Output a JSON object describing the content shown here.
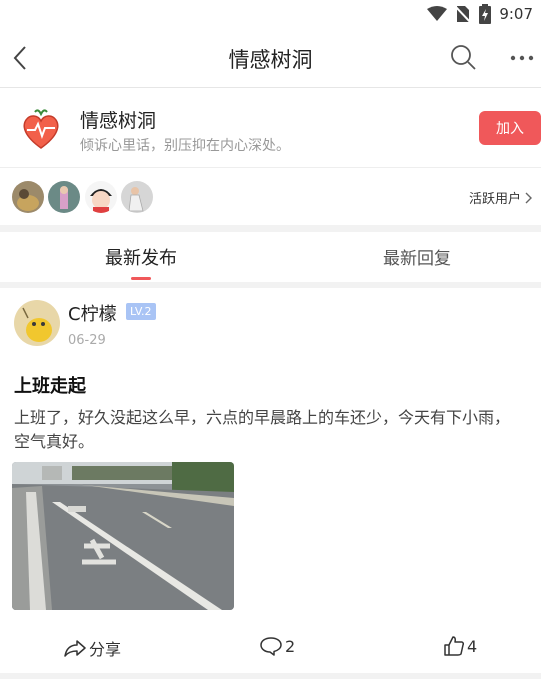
{
  "status_bar": {
    "time": "9:07"
  },
  "header": {
    "title": "情感树洞"
  },
  "group": {
    "name": "情感树洞",
    "description": "倾诉心里话，别压抑在内心深处。",
    "join_label": "加入"
  },
  "active_users": {
    "label": "活跃用户"
  },
  "tabs": [
    {
      "label": "最新发布"
    },
    {
      "label": "最新回复"
    }
  ],
  "post": {
    "author": "C柠檬",
    "level": "LV.2",
    "date": "06-29",
    "title": "上班走起",
    "body": "上班了，好久没起这么早，六点的早晨路上的车还少，今天有下小雨，空气真好。",
    "share_label": "分享",
    "comment_count": "2",
    "like_count": "4"
  },
  "colors": {
    "accent": "#f0585a",
    "level_badge": "#a9c4f5"
  }
}
